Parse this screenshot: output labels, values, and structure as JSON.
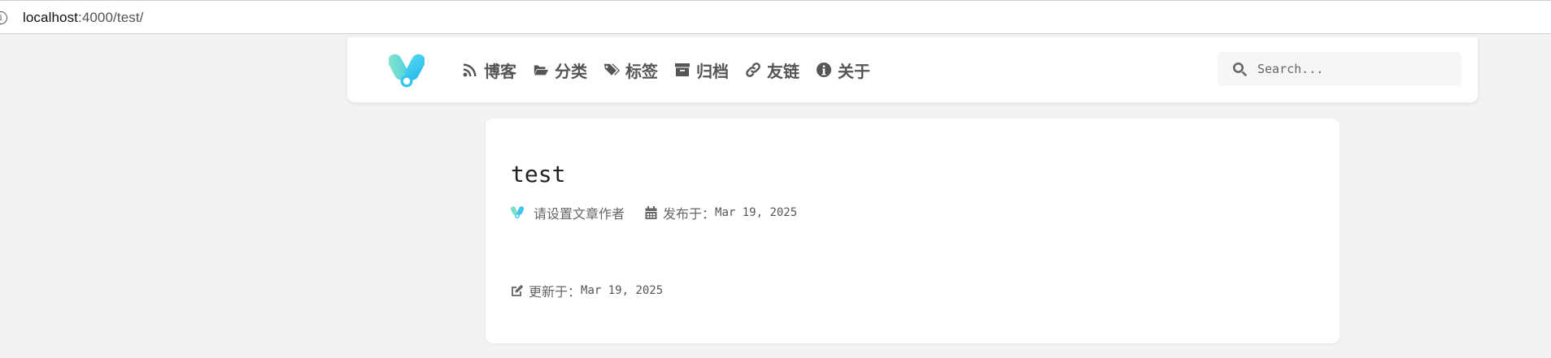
{
  "browser": {
    "url_host": "localhost",
    "url_rest": ":4000/test/"
  },
  "header": {
    "search_placeholder": "Search...",
    "nav": [
      {
        "label": "博客",
        "icon": "rss-icon"
      },
      {
        "label": "分类",
        "icon": "folder-open-icon"
      },
      {
        "label": "标签",
        "icon": "tags-icon"
      },
      {
        "label": "归档",
        "icon": "archive-icon"
      },
      {
        "label": "友链",
        "icon": "link-icon"
      },
      {
        "label": "关于",
        "icon": "info-circle-icon"
      }
    ]
  },
  "post": {
    "title": "test",
    "author": "请设置文章作者",
    "published_label": "发布于：",
    "published_date": "Mar 19, 2025",
    "updated_label": "更新于：",
    "updated_date": "Mar 19, 2025"
  },
  "colors": {
    "logo_gradient_start": "#7ee0c8",
    "logo_gradient_end": "#3fc4f0",
    "background": "#f3f3f3",
    "card": "#ffffff"
  }
}
